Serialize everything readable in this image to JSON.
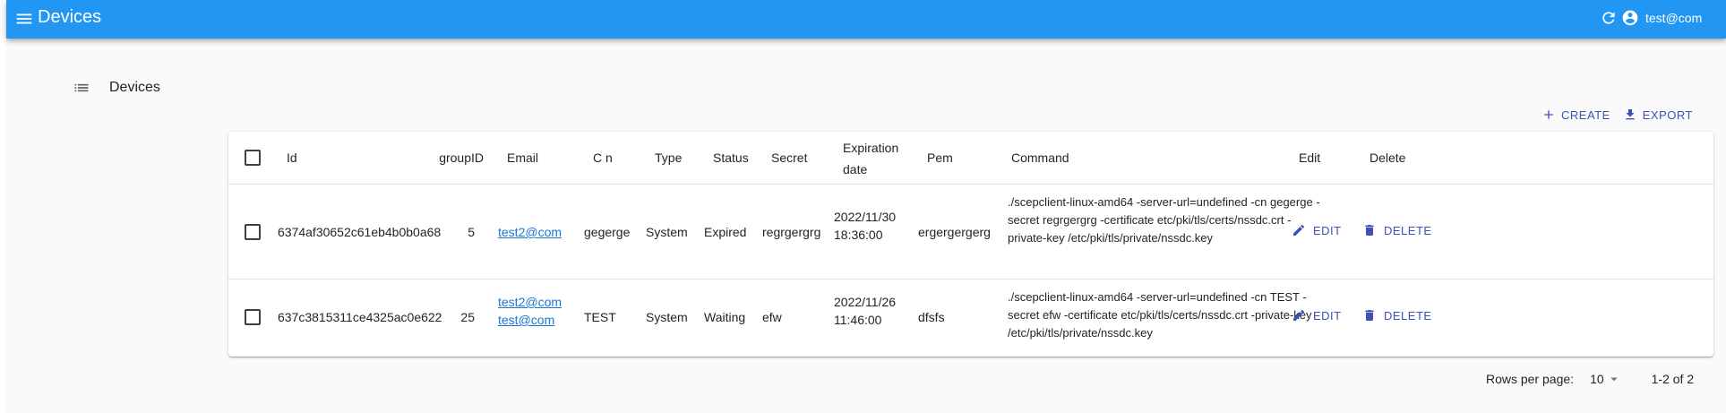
{
  "appbar": {
    "title": "Devices",
    "user": "test@com",
    "icons": [
      "menu-icon",
      "refresh-icon",
      "account-circle-icon"
    ]
  },
  "page": {
    "heading": "Devices"
  },
  "actions": {
    "create_label": "CREATE",
    "export_label": "EXPORT"
  },
  "table": {
    "columns": [
      "Id",
      "groupID",
      "Email",
      "C n",
      "Type",
      "Status",
      "Secret",
      "Expiration date",
      "Pem",
      "Command",
      "Edit",
      "Delete"
    ],
    "rows": [
      {
        "id": "6374af30652c61eb4b0b0a68",
        "groupID": "5",
        "emails": [
          "test2@com"
        ],
        "cn": "gegerge",
        "type": "System",
        "status": "Expired",
        "secret": "regrgergrg",
        "expiration_date": "2022/11/30",
        "expiration_time": "18:36:00",
        "pem": "ergergergerg",
        "command": "./scepclient-linux-amd64 -server-url=undefined -cn gegerge -secret regrgergrg -certificate etc/pki/tls/certs/nssdc.crt -private-key /etc/pki/tls/private/nssdc.key",
        "edit_label": "EDIT",
        "delete_label": "DELETE"
      },
      {
        "id": "637c3815311ce4325ac0e622",
        "groupID": "25",
        "emails": [
          "test2@com",
          "test@com"
        ],
        "cn": "TEST",
        "type": "System",
        "status": "Waiting",
        "secret": "efw",
        "expiration_date": "2022/11/26",
        "expiration_time": "11:46:00",
        "pem": "dfsfs",
        "command": "./scepclient-linux-amd64 -server-url=undefined -cn TEST -secret efw -certificate etc/pki/tls/certs/nssdc.crt -private-key /etc/pki/tls/private/nssdc.key",
        "edit_label": "EDIT",
        "delete_label": "DELETE"
      }
    ]
  },
  "pagination": {
    "rows_per_page_label": "Rows per page:",
    "rows_per_page": "10",
    "range": "1-2 of 2"
  },
  "colors": {
    "appbar": "#2196f3",
    "accent": "#3f51b5",
    "link": "#1976d2"
  }
}
